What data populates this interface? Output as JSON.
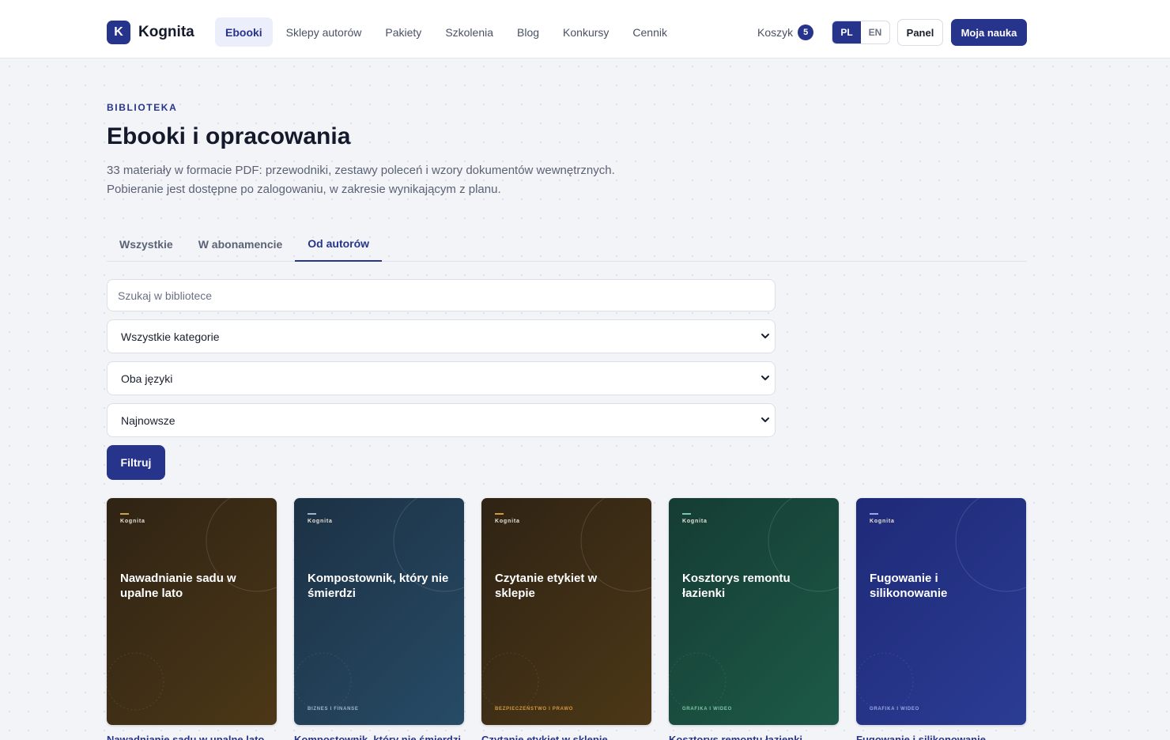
{
  "header": {
    "logo_letter": "K",
    "brand": "Kognita",
    "nav": [
      {
        "label": "Ebooki",
        "active": true
      },
      {
        "label": "Sklepy autorów",
        "active": false
      },
      {
        "label": "Pakiety",
        "active": false
      },
      {
        "label": "Szkolenia",
        "active": false
      },
      {
        "label": "Blog",
        "active": false
      },
      {
        "label": "Konkursy",
        "active": false
      },
      {
        "label": "Cennik",
        "active": false
      }
    ],
    "cart_label": "Koszyk",
    "cart_count": "5",
    "lang": {
      "pl": "PL",
      "en": "EN",
      "active": "PL"
    },
    "panel_label": "Panel",
    "cta_label": "Moja nauka"
  },
  "hero": {
    "eyebrow": "BIBLIOTEKA",
    "title": "Ebooki i opracowania",
    "lead_line1": "33 materiały w formacie PDF: przewodniki, zestawy poleceń i wzory dokumentów wewnętrznych.",
    "lead_line2": "Pobieranie jest dostępne po zalogowaniu, w zakresie wynikającym z planu."
  },
  "tabs": [
    {
      "label": "Wszystkie",
      "active": false
    },
    {
      "label": "W abonamencie",
      "active": false
    },
    {
      "label": "Od autorów",
      "active": true
    }
  ],
  "filters": {
    "search_placeholder": "Szukaj w bibliotece",
    "category": "Wszystkie kategorie",
    "language": "Oba języki",
    "sort": "Najnowsze",
    "submit": "Filtruj"
  },
  "colors": {
    "accent": "#27348b"
  },
  "cards": [
    {
      "brand": "Kognita",
      "title": "Nawadnianie sadu w upalne lato",
      "category": "",
      "link": "Nawadnianie sadu w upalne lato",
      "bg1": "#2f2314",
      "bg2": "#4c3817",
      "accent": "#c9a24a",
      "cat_color": "#c9a24a"
    },
    {
      "brand": "Kognita",
      "title": "Kompostownik, który nie śmierdzi",
      "category": "BIZNES I FINANSE",
      "link": "Kompostownik, który nie śmierdzi",
      "bg1": "#1c3144",
      "bg2": "#274b66",
      "accent": "#9fb6c9",
      "cat_color": "#9fb6c9"
    },
    {
      "brand": "Kognita",
      "title": "Czytanie etykiet w sklepie",
      "category": "BEZPIECZEŃSTWO I PRAWO",
      "link": "Czytanie etykiet w sklepie",
      "bg1": "#2f2314",
      "bg2": "#4c3817",
      "accent": "#d39a3a",
      "cat_color": "#d39a3a"
    },
    {
      "brand": "Kognita",
      "title": "Kosztorys remontu łazienki",
      "category": "GRAFIKA I WIDEO",
      "link": "Kosztorys remontu łazienki",
      "bg1": "#153c33",
      "bg2": "#1d5a47",
      "accent": "#7cc7a3",
      "cat_color": "#7cc7a3"
    },
    {
      "brand": "Kognita",
      "title": "Fugowanie i silikonowanie",
      "category": "GRAFIKA I WIDEO",
      "link": "Fugowanie i silikonowanie",
      "bg1": "#1f2a78",
      "bg2": "#2b3c93",
      "accent": "#9aa6e6",
      "cat_color": "#9aa6e6"
    }
  ]
}
